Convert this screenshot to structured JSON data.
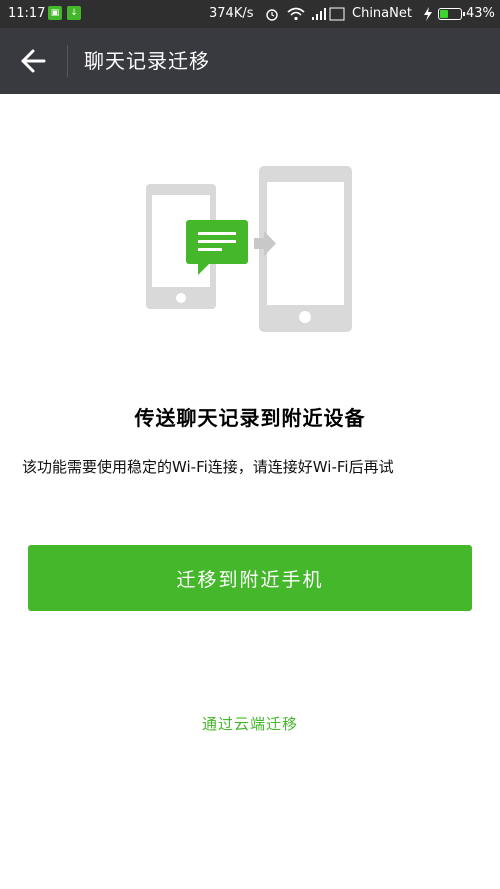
{
  "status_bar": {
    "time": "11:17",
    "speed": "374K/s",
    "network_label": "ChinaNet",
    "battery_percent": "43%",
    "battery_level": 0.43,
    "icons": [
      "sim-notification-icon",
      "download-icon",
      "alarm-icon",
      "wifi-icon",
      "signal-icon",
      "charging-icon",
      "battery-icon"
    ]
  },
  "app_bar": {
    "title": "聊天记录迁移",
    "back_icon": "back-arrow-icon"
  },
  "illustration": {
    "icons": [
      "phone-source-icon",
      "chat-bubble-icon",
      "transfer-arrow-icon",
      "phone-target-icon"
    ],
    "colors": {
      "device": "#d9d9d9",
      "bubble": "#44b72b"
    }
  },
  "main": {
    "headline": "传送聊天记录到附近设备",
    "description": "该功能需要使用稳定的Wi-Fi连接，请连接好Wi-Fi后再试",
    "primary_button": "迁移到附近手机",
    "cloud_link": "通过云端迁移"
  },
  "colors": {
    "accent": "#44b72b",
    "app_bar": "#393a3f",
    "status_bar": "#2f2f2f"
  }
}
